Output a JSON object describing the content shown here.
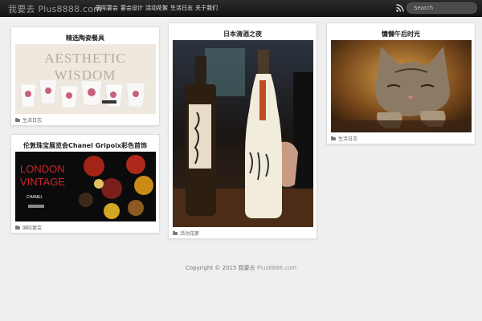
{
  "header": {
    "logo_prefix": "我要去",
    "logo_site": "Plus8888.com",
    "nav": [
      "国际宴会",
      "宴会设计",
      "活动花絮",
      "生活日志",
      "关于我们"
    ],
    "search_placeholder": "Search"
  },
  "posts": [
    {
      "title": "精选陶瓷餐具",
      "category": "生活日志",
      "img_text_1": "AESTHETIC",
      "img_text_2": "WISDOM"
    },
    {
      "title": "日本清酒之夜",
      "category": "活动花絮"
    },
    {
      "title": "慵懒午后时光",
      "category": "生活日志"
    },
    {
      "title": "伦敦珠宝展览会Chanel Gripoix彩色首饰",
      "category": "国际宴会",
      "img_text_1": "LONDON",
      "img_text_2": "VINTAGE",
      "img_text_3": "CHANEL"
    }
  ],
  "footer": {
    "copyright": "Copyright © 2015 我要去",
    "site": "Plus8888.com"
  },
  "colors": {
    "topbar": "#1c1c1c",
    "background": "#efefef",
    "card": "#ffffff"
  }
}
